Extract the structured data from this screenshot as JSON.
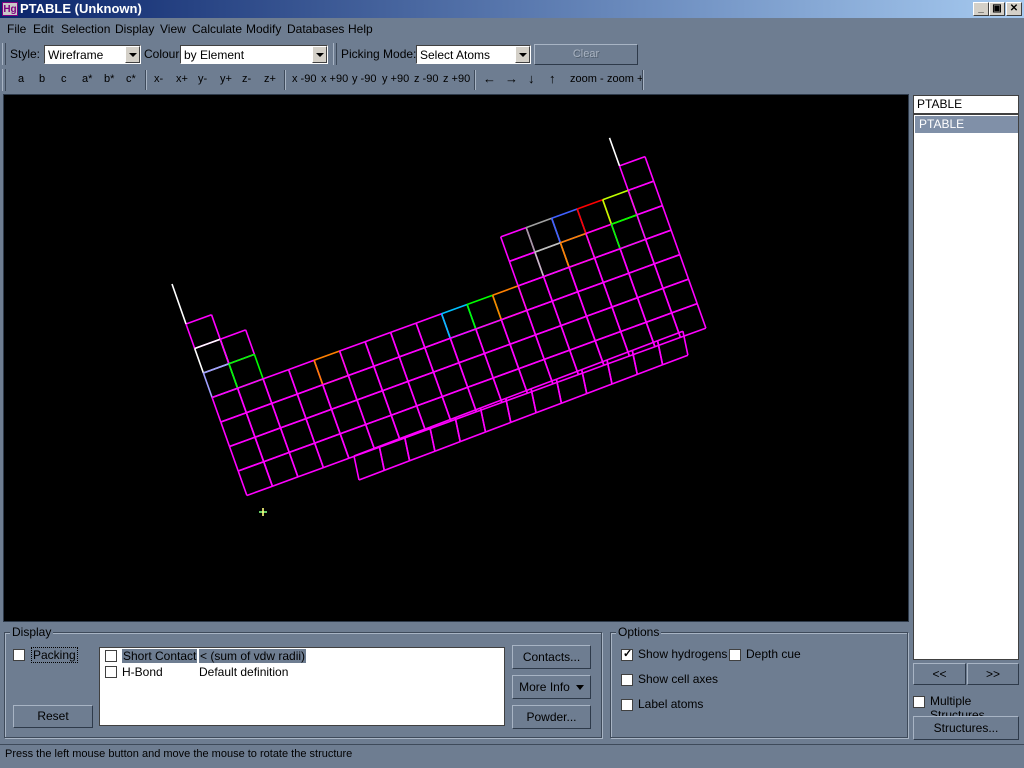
{
  "window": {
    "icon_text": "Hg",
    "title": "PTABLE (Unknown)",
    "minimize": "_",
    "maximize": "▣",
    "close": "✕"
  },
  "menu": [
    "File",
    "Edit",
    "Selection",
    "Display",
    "View",
    "Calculate",
    "Modify",
    "Databases",
    "Help"
  ],
  "toolbar1": {
    "style_label": "Style:",
    "style_value": "Wireframe",
    "colour_label": "Colour:",
    "colour_value": "by Element",
    "picking_label": "Picking Mode:",
    "picking_value": "Select Atoms",
    "clear_measurements": "Clear Measurements"
  },
  "toolbar2": {
    "axes": [
      "a",
      "b",
      "c",
      "a*",
      "b*",
      "c*"
    ],
    "moves": [
      "x-",
      "x+",
      "y-",
      "y+",
      "z-",
      "z+"
    ],
    "rotations": [
      "x -90",
      "x +90",
      "y -90",
      "y +90",
      "z -90",
      "z +90"
    ],
    "arrows": [
      "←",
      "→",
      "↓",
      "↑"
    ],
    "zoom": [
      "zoom -",
      "zoom +"
    ]
  },
  "structures": {
    "name_value": "PTABLE",
    "list": [
      "PTABLE"
    ],
    "prev": "<<",
    "next": ">>",
    "multiple_label": "Multiple Structures",
    "structures_button": "Structures..."
  },
  "display_group": {
    "title": "Display",
    "packing": "Packing",
    "reset": "Reset",
    "contacts": [
      {
        "name": "Short Contact",
        "definition": "< (sum of vdw radii)"
      },
      {
        "name": "H-Bond",
        "definition": "Default definition"
      }
    ],
    "contacts_button": "Contacts...",
    "more_info_button": "More Info",
    "powder_button": "Powder..."
  },
  "options_group": {
    "title": "Options",
    "show_hydrogens": "Show hydrogens",
    "show_hydrogens_checked": true,
    "depth_cue": "Depth cue",
    "show_cell_axes": "Show cell axes",
    "label_atoms": "Label atoms"
  },
  "status": "Press the left mouse button and move the mouse to rotate the structure",
  "colors": {
    "wire": "#ff00ff",
    "background": "#000000",
    "panel": "#6e7d91"
  }
}
